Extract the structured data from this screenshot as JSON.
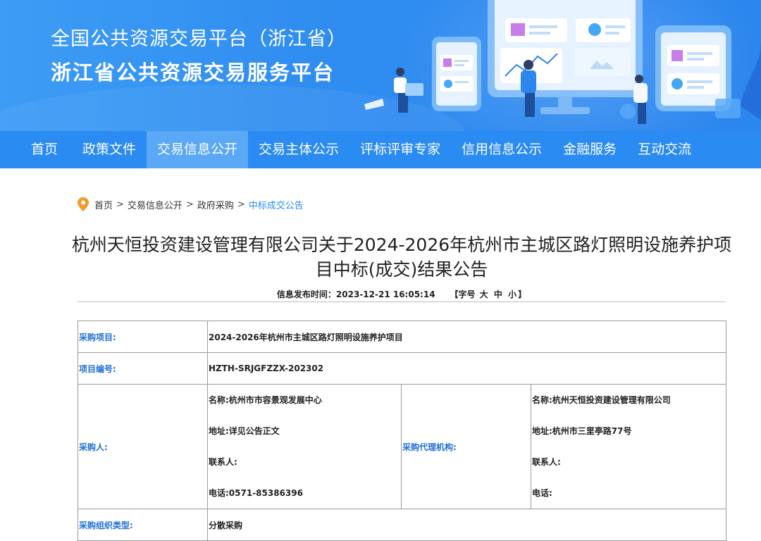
{
  "header": {
    "title_line1": "全国公共资源交易平台（浙江省）",
    "title_line2": "浙江省公共资源交易服务平台"
  },
  "nav": {
    "items": [
      {
        "label": "首页",
        "active": false
      },
      {
        "label": "政策文件",
        "active": false
      },
      {
        "label": "交易信息公开",
        "active": true
      },
      {
        "label": "交易主体公示",
        "active": false
      },
      {
        "label": "评标评审专家",
        "active": false
      },
      {
        "label": "信用信息公示",
        "active": false
      },
      {
        "label": "金融服务",
        "active": false
      },
      {
        "label": "互动交流",
        "active": false
      }
    ]
  },
  "breadcrumb": {
    "home": "首页",
    "level1": "交易信息公开",
    "level2": "政府采购",
    "current": "中标成交公告",
    "separator": ">"
  },
  "article": {
    "title": "杭州天恒投资建设管理有限公司关于2024-2026年杭州市主城区路灯照明设施养护项目中标(成交)结果公告",
    "publish_label": "信息发布时间：",
    "publish_time": "2023-12-21 16:05:14",
    "font_size_open": "【字号",
    "font_large": "大",
    "font_medium": "中",
    "font_small": "小",
    "font_size_close": "】"
  },
  "table": {
    "project_label": "采购项目:",
    "project_value": "2024-2026年杭州市主城区路灯照明设施养护项目",
    "number_label": "项目编号:",
    "number_value": "HZTH-SRJGFZZX-202302",
    "purchaser_label": "采购人:",
    "purchaser_name": "名称:杭州市市容景观发展中心",
    "purchaser_address": "地址:详见公告正文",
    "purchaser_contact": "联系人:",
    "purchaser_phone": "电话:0571-85386396",
    "agency_label": "采购代理机构:",
    "agency_name": "名称:杭州天恒投资建设管理有限公司",
    "agency_address": "地址:杭州市三里亭路77号",
    "agency_contact": "联系人:",
    "agency_phone": "电话:",
    "org_type_label": "采购组织类型:",
    "org_type_value": "分散采购"
  },
  "colors": {
    "banner_blue": "#2f8cf0",
    "nav_blue": "#2a8bf2",
    "nav_active": "#5aa8f6",
    "label_blue": "#1f6fd8",
    "pin_orange": "#f39a2b"
  }
}
